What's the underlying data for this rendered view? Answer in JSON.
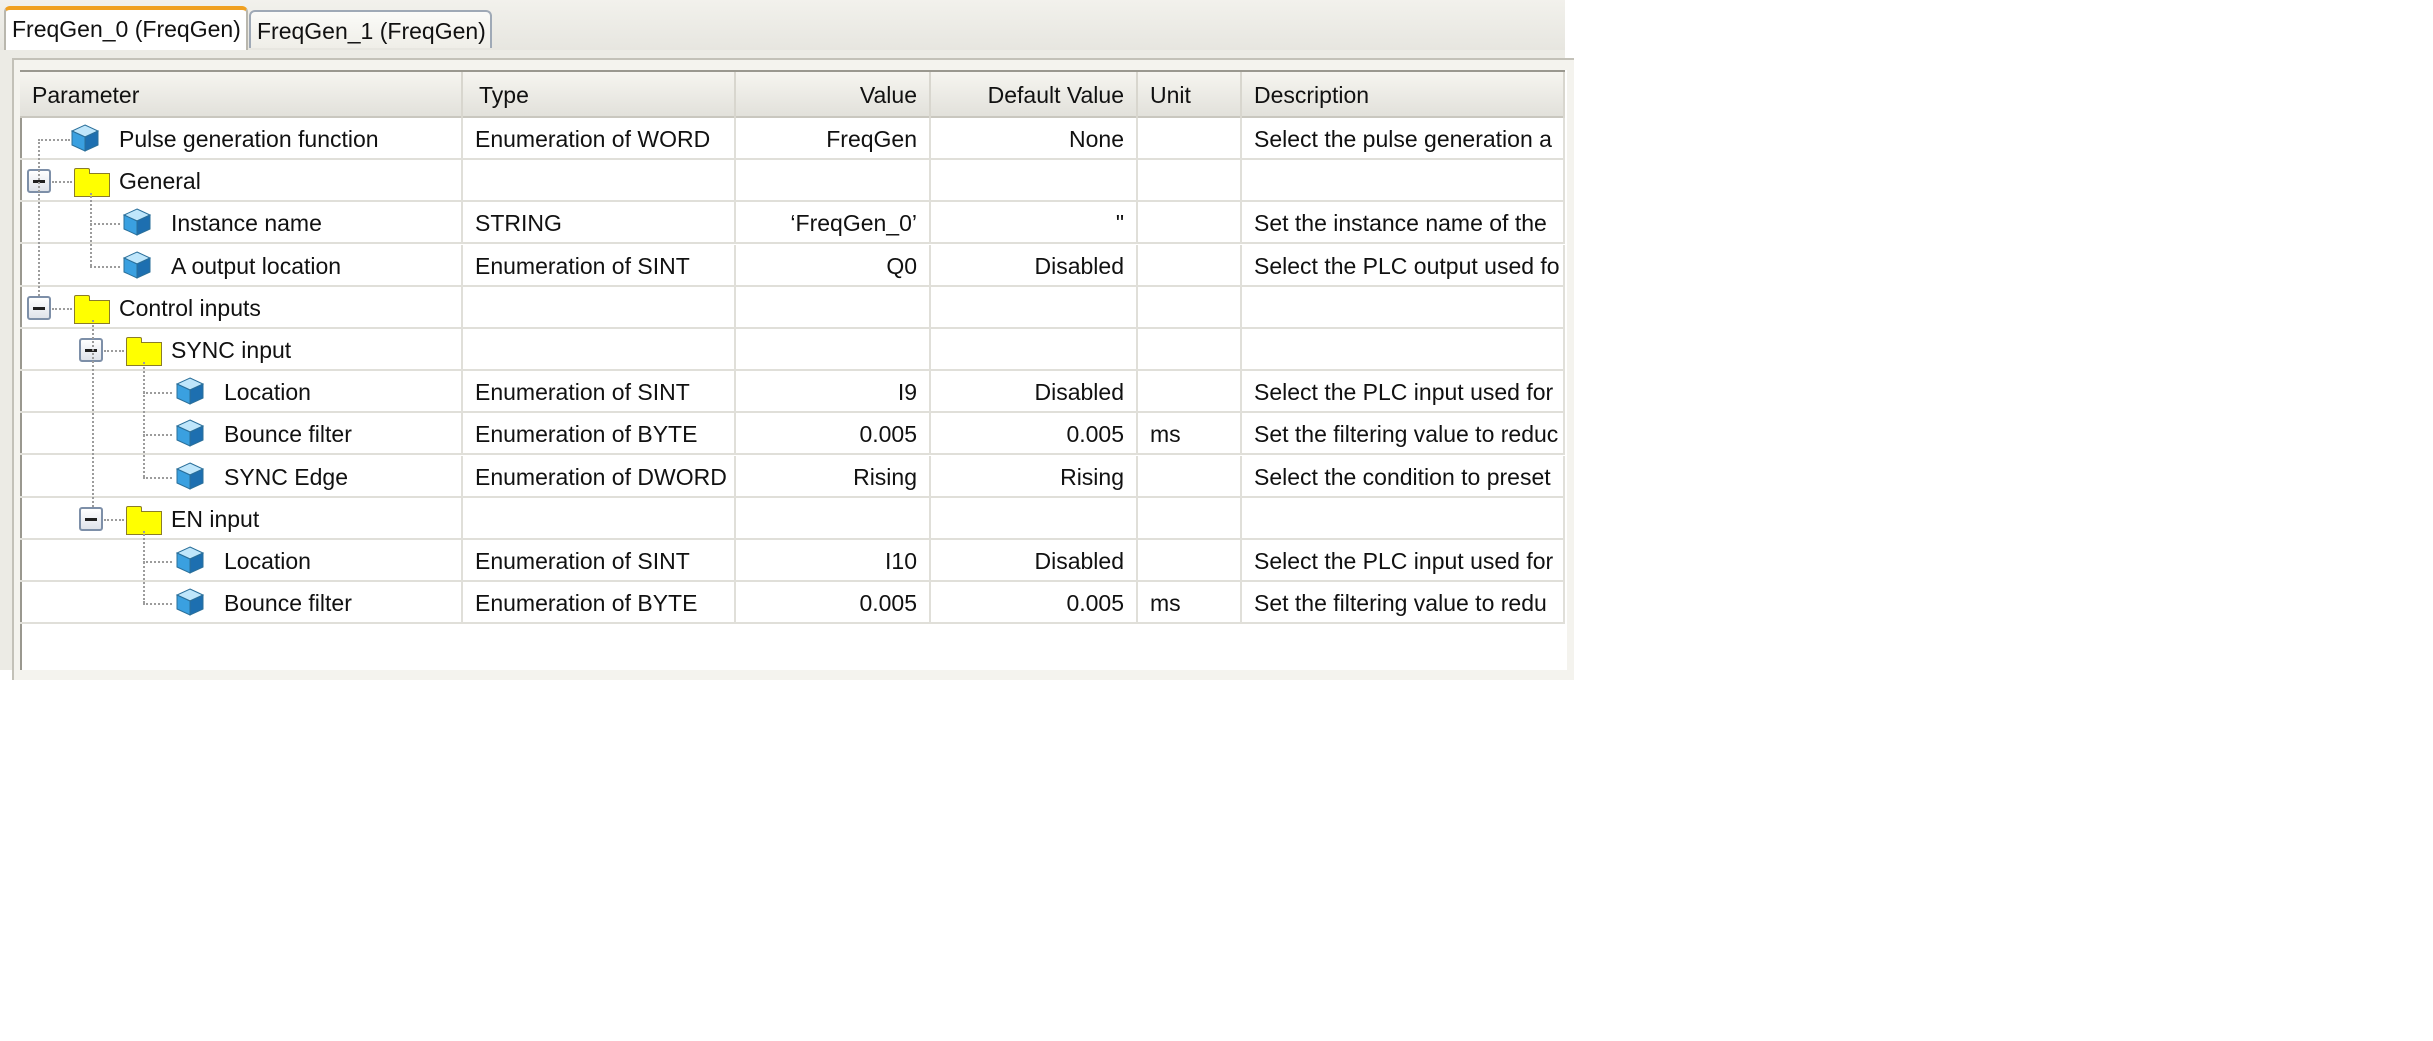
{
  "tabs": [
    {
      "label": "FreqGen_0 (FreqGen)",
      "active": true
    },
    {
      "label": "FreqGen_1 (FreqGen)",
      "active": false
    }
  ],
  "columns": {
    "parameter": "Parameter",
    "type": "Type",
    "value": "Value",
    "default_value": "Default Value",
    "unit": "Unit",
    "description": "Description"
  },
  "rows": [
    {
      "parameter": "Pulse generation function",
      "type": "Enumeration of WORD",
      "value": "FreqGen",
      "default": "None",
      "unit": "",
      "description": "Select the pulse generation a",
      "kind": "param",
      "level": 0
    },
    {
      "parameter": "General",
      "type": "",
      "value": "",
      "default": "",
      "unit": "",
      "description": "",
      "kind": "folder",
      "level": 0
    },
    {
      "parameter": "Instance name",
      "type": "STRING",
      "value": "‘FreqGen_0’",
      "default": "\"",
      "unit": "",
      "description": "Set the instance name of the",
      "kind": "param",
      "level": 1
    },
    {
      "parameter": "A output location",
      "type": "Enumeration of SINT",
      "value": "Q0",
      "default": "Disabled",
      "unit": "",
      "description": "Select the PLC output used fo",
      "kind": "param",
      "level": 1
    },
    {
      "parameter": "Control inputs",
      "type": "",
      "value": "",
      "default": "",
      "unit": "",
      "description": "",
      "kind": "folder",
      "level": 0
    },
    {
      "parameter": "SYNC input",
      "type": "",
      "value": "",
      "default": "",
      "unit": "",
      "description": "",
      "kind": "folder",
      "level": 1
    },
    {
      "parameter": "Location",
      "type": "Enumeration of SINT",
      "value": "I9",
      "default": "Disabled",
      "unit": "",
      "description": "Select the PLC input used for",
      "kind": "param",
      "level": 2
    },
    {
      "parameter": "Bounce filter",
      "type": "Enumeration of BYTE",
      "value": "0.005",
      "default": "0.005",
      "unit": "ms",
      "description": "Set the filtering value to reduc",
      "kind": "param",
      "level": 2
    },
    {
      "parameter": "SYNC Edge",
      "type": "Enumeration of DWORD",
      "value": "Rising",
      "default": "Rising",
      "unit": "",
      "description": "Select the condition to preset",
      "kind": "param",
      "level": 2
    },
    {
      "parameter": "EN input",
      "type": "",
      "value": "",
      "default": "",
      "unit": "",
      "description": "",
      "kind": "folder",
      "level": 1
    },
    {
      "parameter": "Location",
      "type": "Enumeration of SINT",
      "value": "I10",
      "default": "Disabled",
      "unit": "",
      "description": "Select the PLC input used for",
      "kind": "param",
      "level": 2
    },
    {
      "parameter": "Bounce filter",
      "type": "Enumeration of BYTE",
      "value": "0.005",
      "default": "0.005",
      "unit": "ms",
      "description": "Set the filtering value to redu",
      "kind": "param",
      "level": 2
    }
  ],
  "icons": {
    "parameter": "cube-icon",
    "group": "folder-icon",
    "expander": "collapse-icon"
  },
  "colors": {
    "folder": "#ffff00",
    "active_tab_accent": "#f0a020",
    "cube_blue": "#3aa0e0"
  }
}
